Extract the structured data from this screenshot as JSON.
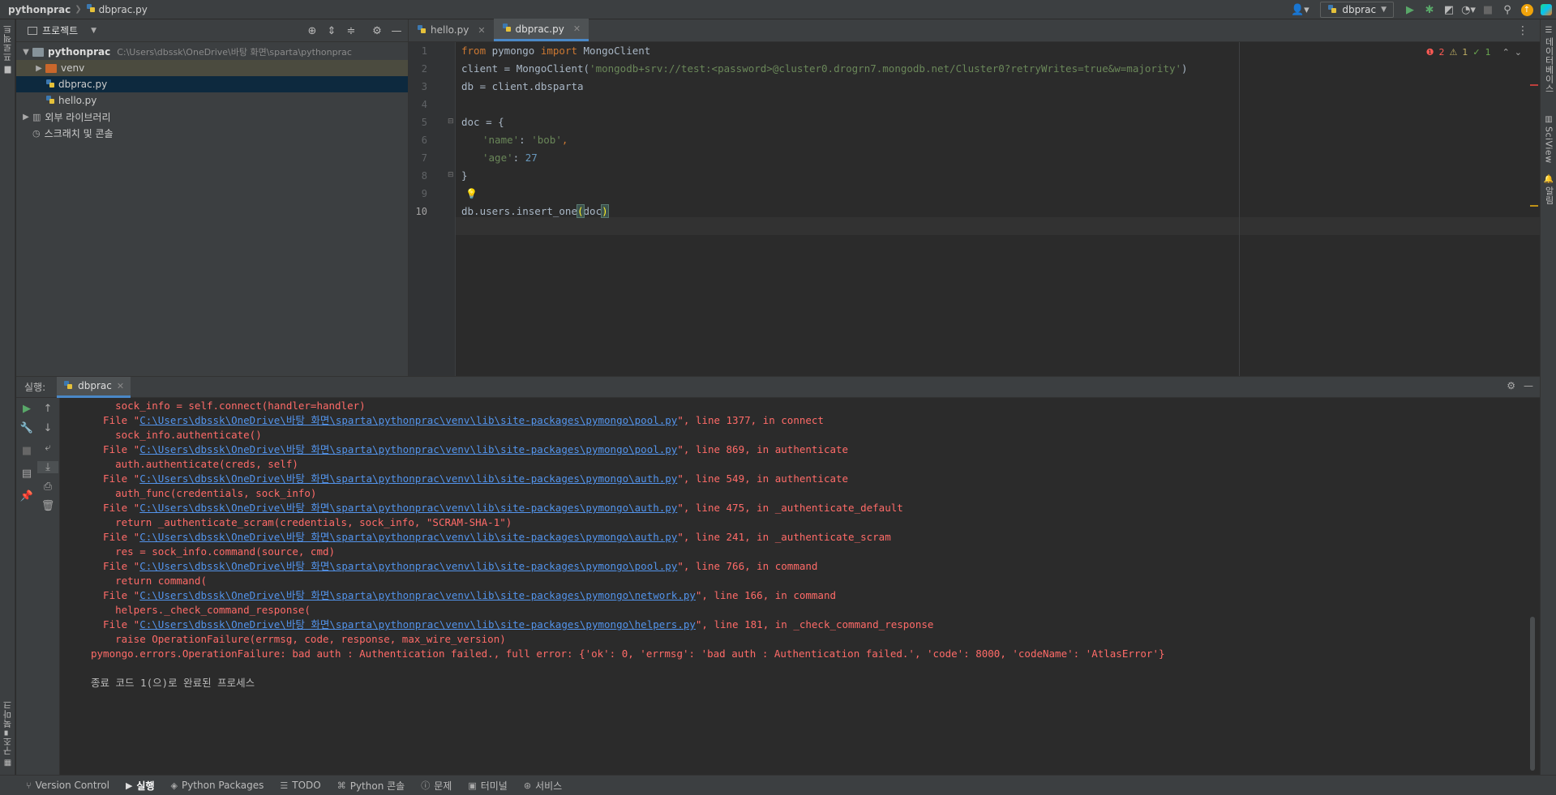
{
  "titlebar": {
    "project": "pythonprac",
    "file": "dbprac.py",
    "run_config": "dbprac"
  },
  "left_strip": {
    "project_tab": "프로젝트",
    "bookmarks_tab": "북마크",
    "structure_tab": "구조"
  },
  "right_strip": {
    "database_tab": "데이터베이스",
    "sciview_tab": "SciView",
    "notifications_tab": "알림"
  },
  "project": {
    "title": "프로젝트",
    "root_name": "pythonprac",
    "root_path": "C:\\Users\\dbssk\\OneDrive\\바탕 화면\\sparta\\pythonprac",
    "items": [
      {
        "label": "venv"
      },
      {
        "label": "dbprac.py"
      },
      {
        "label": "hello.py"
      },
      {
        "label": "외부 라이브러리"
      },
      {
        "label": "스크래치 및 콘솔"
      }
    ]
  },
  "editor": {
    "tabs": [
      {
        "label": "hello.py"
      },
      {
        "label": "dbprac.py"
      }
    ],
    "inspections": {
      "errors": "2",
      "warnings": "1",
      "ok": "1"
    },
    "line_numbers": [
      "1",
      "2",
      "3",
      "4",
      "5",
      "6",
      "7",
      "8",
      "9",
      "10"
    ],
    "code": {
      "l1_kw1": "from",
      "l1_mod": " pymongo ",
      "l1_kw2": "import",
      "l1_name": " MongoClient",
      "l2_pre": "client = MongoClient(",
      "l2_str": "'mongodb+srv://test:<password>@cluster0.drogrn7.mongodb.net/Cluster0?retryWrites=true&w=majority'",
      "l2_post": ")",
      "l3": "db = client.dbsparta",
      "l5": "doc = {",
      "l6_key": "'name'",
      "l6_sep": ": ",
      "l6_val": "'bob'",
      "l6_end": ",",
      "l7_key": "'age'",
      "l7_sep": ": ",
      "l7_val": "27",
      "l8": "}",
      "l10_pre": "db.users.insert_one",
      "l10_open": "(",
      "l10_arg": "doc",
      "l10_close": ")"
    }
  },
  "run": {
    "label": "실행:",
    "tab": "dbprac",
    "output": {
      "o1": "    sock_info = self.connect(handler=handler)",
      "f1_pre": "  File \"",
      "f1_link": "C:\\Users\\dbssk\\OneDrive\\바탕 화면\\sparta\\pythonprac\\venv\\lib\\site-packages\\pymongo\\pool.py",
      "f1_post": "\", line 1377, in connect",
      "o2": "    sock_info.authenticate()",
      "f2_pre": "  File \"",
      "f2_link": "C:\\Users\\dbssk\\OneDrive\\바탕 화면\\sparta\\pythonprac\\venv\\lib\\site-packages\\pymongo\\pool.py",
      "f2_post": "\", line 869, in authenticate",
      "o3": "    auth.authenticate(creds, self)",
      "f3_pre": "  File \"",
      "f3_link": "C:\\Users\\dbssk\\OneDrive\\바탕 화면\\sparta\\pythonprac\\venv\\lib\\site-packages\\pymongo\\auth.py",
      "f3_post": "\", line 549, in authenticate",
      "o4": "    auth_func(credentials, sock_info)",
      "f4_pre": "  File \"",
      "f4_link": "C:\\Users\\dbssk\\OneDrive\\바탕 화면\\sparta\\pythonprac\\venv\\lib\\site-packages\\pymongo\\auth.py",
      "f4_post": "\", line 475, in _authenticate_default",
      "o5": "    return _authenticate_scram(credentials, sock_info, \"SCRAM-SHA-1\")",
      "f5_pre": "  File \"",
      "f5_link": "C:\\Users\\dbssk\\OneDrive\\바탕 화면\\sparta\\pythonprac\\venv\\lib\\site-packages\\pymongo\\auth.py",
      "f5_post": "\", line 241, in _authenticate_scram",
      "o6": "    res = sock_info.command(source, cmd)",
      "f6_pre": "  File \"",
      "f6_link": "C:\\Users\\dbssk\\OneDrive\\바탕 화면\\sparta\\pythonprac\\venv\\lib\\site-packages\\pymongo\\pool.py",
      "f6_post": "\", line 766, in command",
      "o7": "    return command(",
      "f7_pre": "  File \"",
      "f7_link": "C:\\Users\\dbssk\\OneDrive\\바탕 화면\\sparta\\pythonprac\\venv\\lib\\site-packages\\pymongo\\network.py",
      "f7_post": "\", line 166, in command",
      "o8": "    helpers._check_command_response(",
      "f8_pre": "  File \"",
      "f8_link": "C:\\Users\\dbssk\\OneDrive\\바탕 화면\\sparta\\pythonprac\\venv\\lib\\site-packages\\pymongo\\helpers.py",
      "f8_post": "\", line 181, in _check_command_response",
      "o9": "    raise OperationFailure(errmsg, code, response, max_wire_version)",
      "err": "pymongo.errors.OperationFailure: bad auth : Authentication failed., full error: {'ok': 0, 'errmsg': 'bad auth : Authentication failed.', 'code': 8000, 'codeName': 'AtlasError'}",
      "exit": "종료 코드 1(으)로 완료된 프로세스"
    }
  },
  "bottombar": {
    "version_control": "Version Control",
    "run": "실행",
    "python_packages": "Python Packages",
    "todo": "TODO",
    "python_console": "Python 콘솔",
    "problems": "문제",
    "terminal": "터미널",
    "services": "서비스"
  },
  "colors": {
    "accent": "#4a88c7",
    "error": "#ff6b68",
    "link": "#5394ec",
    "keyword": "#cc7832",
    "string": "#6a8759",
    "number": "#6897bb"
  }
}
